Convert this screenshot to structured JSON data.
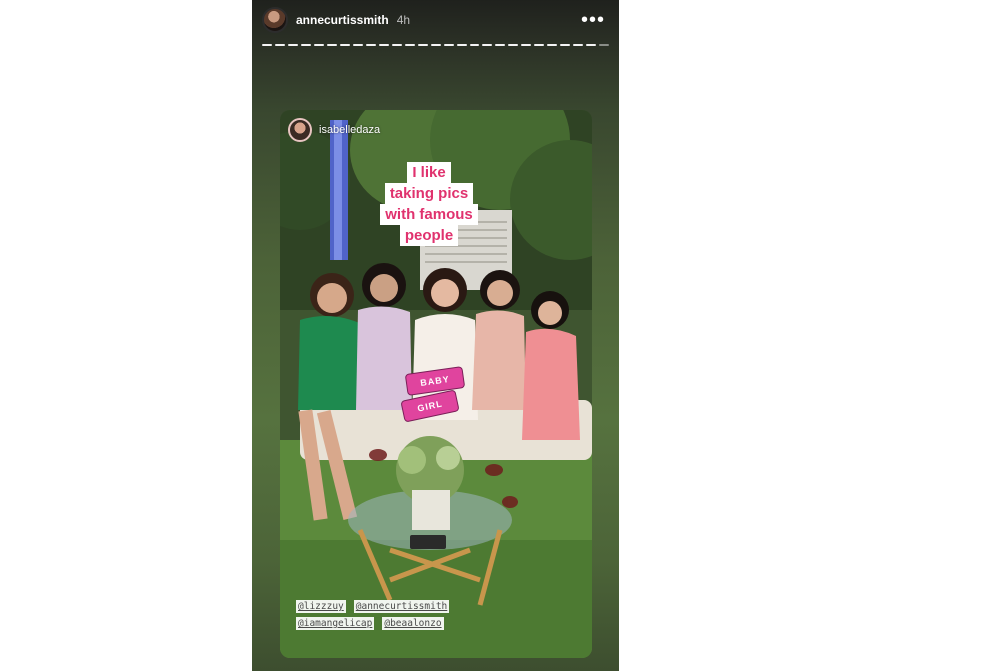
{
  "story": {
    "username": "annecurtissmith",
    "time_ago": "4h",
    "more_label": "•••",
    "segment_count": 27
  },
  "shared_post": {
    "username": "isabelledaza",
    "sticker_lines": [
      "I like",
      "taking pics",
      "with famous",
      "people"
    ],
    "gif_stickers": [
      "BABY",
      "GIRL"
    ],
    "mentions_row1": [
      "@lizzzuy",
      "@annecurtissmith"
    ],
    "mentions_row2": [
      "@iamangelicap",
      "@beaalonzo"
    ]
  },
  "colors": {
    "sticker_text": "#e0326e",
    "gif_pink": "#e0449e"
  }
}
